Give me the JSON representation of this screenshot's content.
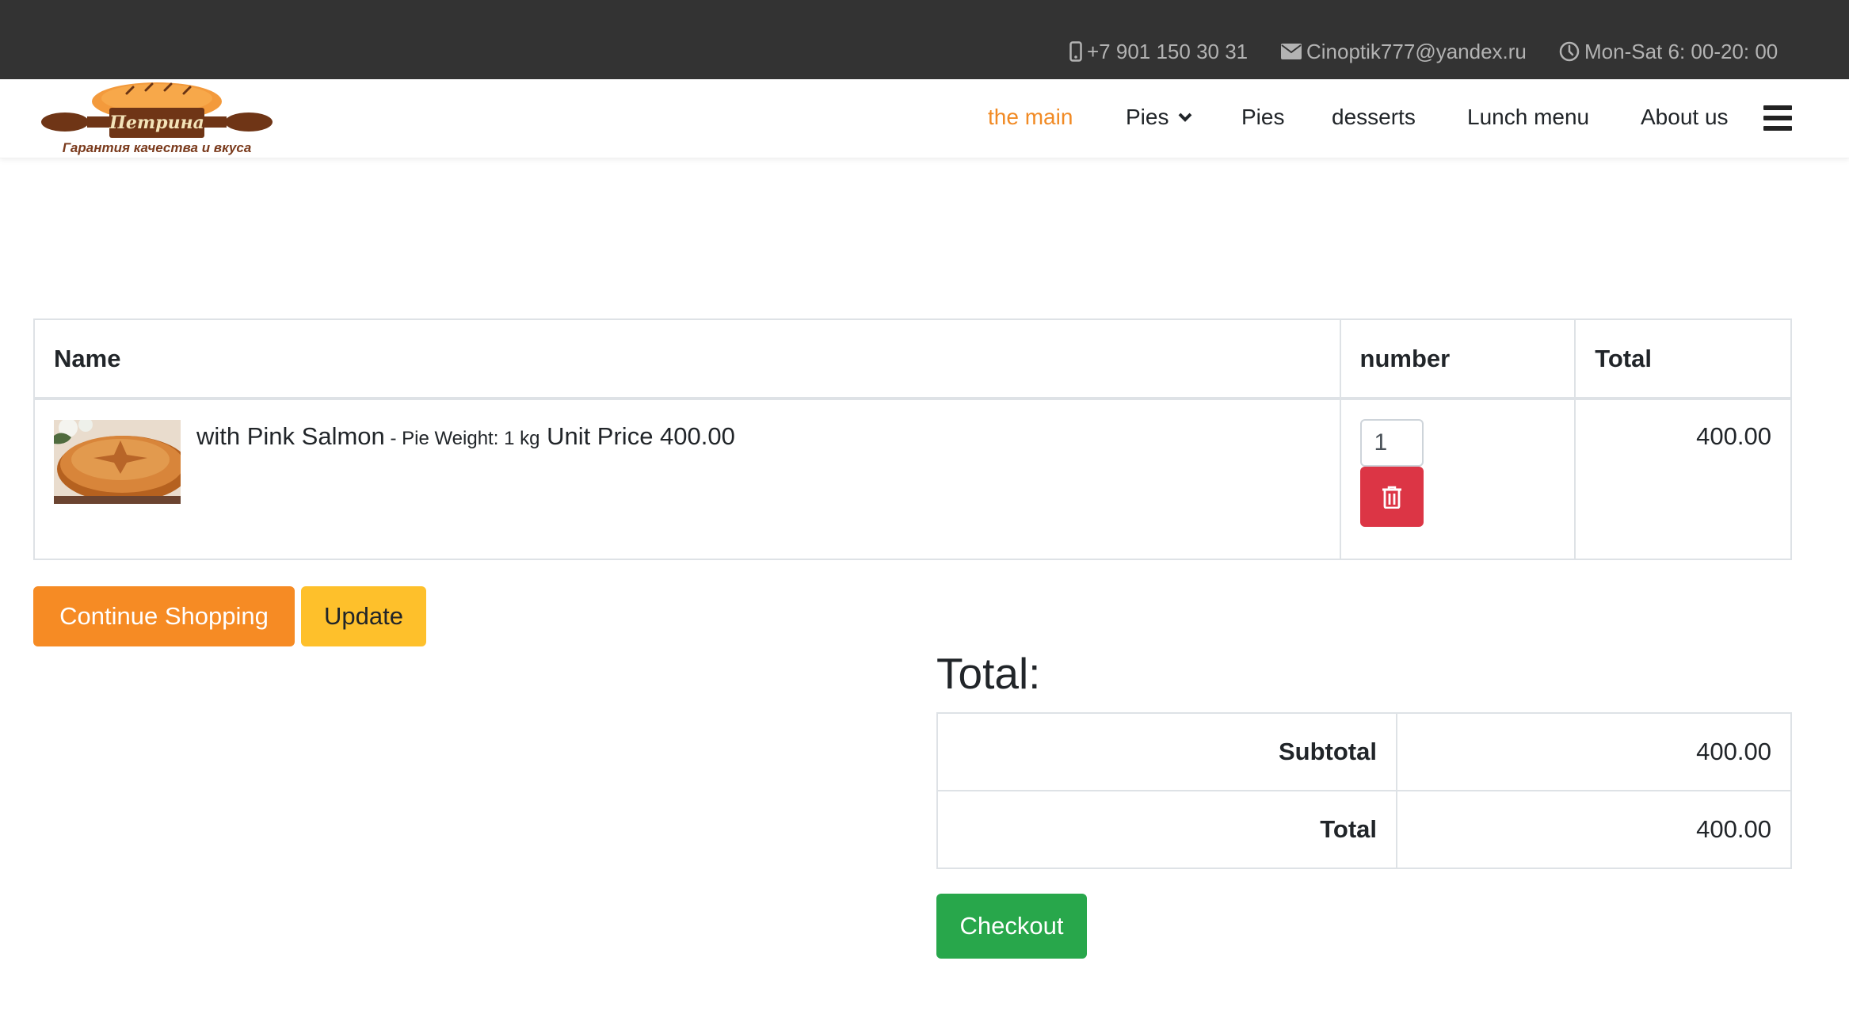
{
  "topbar": {
    "phone_icon": "mobile-phone-icon",
    "phone": "+7 901 150 30 31",
    "email_icon": "envelope-icon",
    "email": "Cinoptik777@yandex.ru",
    "hours_icon": "clock-icon",
    "hours": "Mon-Sat 6: 00-20: 00"
  },
  "brand": {
    "logo_name": "Петрина",
    "logo_tagline": "Гарантия качества и вкуса"
  },
  "nav": {
    "items": [
      {
        "label": "the main",
        "active": true
      },
      {
        "label": "Pies",
        "dropdown": true
      },
      {
        "label": "Pies"
      },
      {
        "label": "desserts"
      },
      {
        "label": "Lunch menu"
      },
      {
        "label": "About us"
      }
    ],
    "menu_icon": "hamburger-menu-icon"
  },
  "cart": {
    "headers": {
      "name": "Name",
      "number": "number",
      "total": "Total"
    },
    "items": [
      {
        "name": "with Pink Salmon",
        "separator": " - ",
        "weight_label": "Pie Weight: 1 kg",
        "unit_price_label": "Unit Price 400.00",
        "quantity": "1",
        "line_total": "400.00",
        "delete_icon": "trash-icon"
      }
    ]
  },
  "actions": {
    "continue_label": "Continue Shopping",
    "update_label": "Update",
    "checkout_label": "Checkout"
  },
  "totals": {
    "heading": "Total:",
    "rows": [
      {
        "label": "Subtotal",
        "value": "400.00"
      },
      {
        "label": "Total",
        "value": "400.00"
      }
    ]
  },
  "colors": {
    "topbar_bg": "#333333",
    "accent_orange": "#f68b24",
    "update_yellow": "#fec02b",
    "danger_red": "#dc3545",
    "success_green": "#28a74b"
  }
}
